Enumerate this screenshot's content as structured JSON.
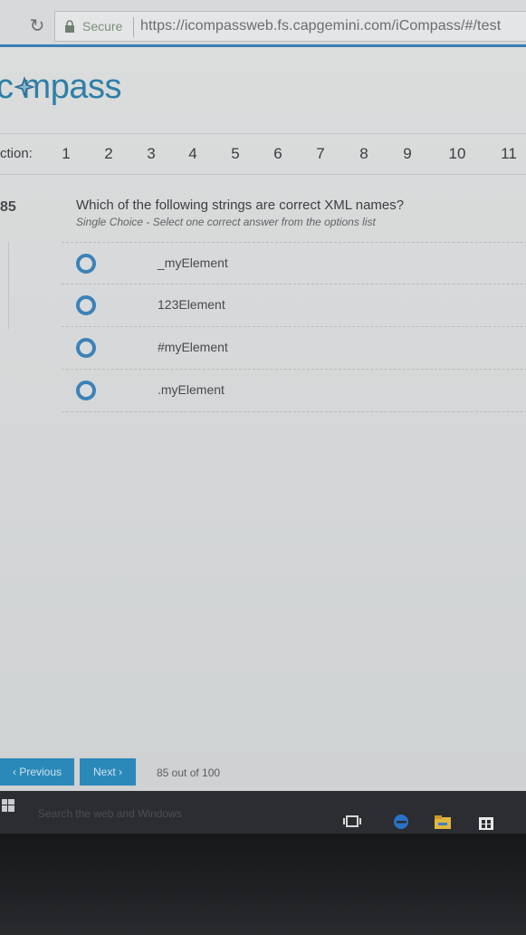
{
  "browser": {
    "secure_label": "Secure",
    "url": "https://icompassweb.fs.capgemini.com/iCompass/#/test"
  },
  "app": {
    "logo_text": "c  mpass",
    "question_nav": {
      "label": "ction:",
      "numbers": [
        "1",
        "2",
        "3",
        "4",
        "5",
        "6",
        "7",
        "8",
        "9",
        "10",
        "11"
      ]
    },
    "question": {
      "number": "85",
      "text": "Which of the following strings are correct XML names?",
      "subtext": "Single Choice - Select one correct answer from the options list",
      "options": [
        "_myElement",
        "123Element",
        "#myElement",
        ".myElement"
      ]
    },
    "footer": {
      "prev_label": "‹ Previous",
      "next_label": "Next ›",
      "progress": "85 out of 100"
    }
  },
  "taskbar": {
    "search_placeholder": "Search the web and Windows"
  },
  "colors": {
    "accent": "#2b89b9",
    "radio": "#3b82b8",
    "logo": "#2f7fa6"
  }
}
